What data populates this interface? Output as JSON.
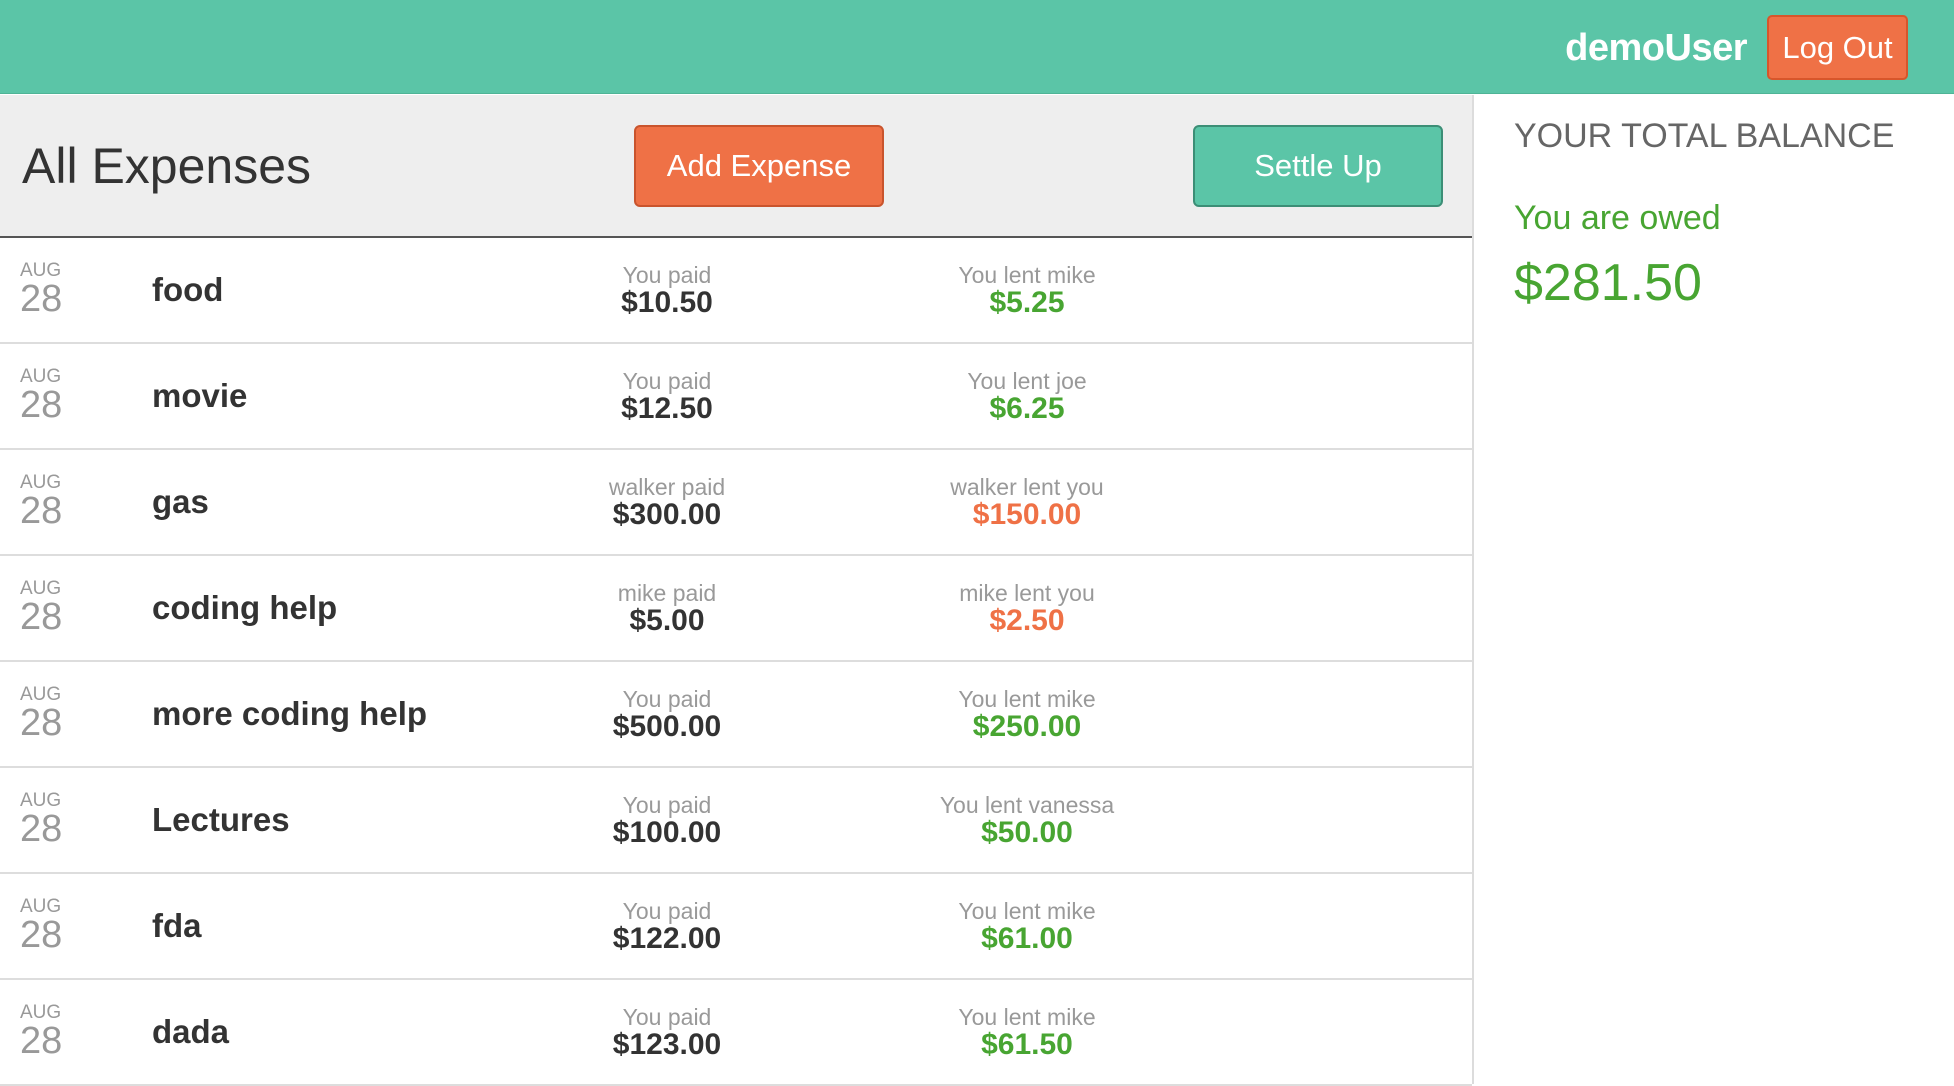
{
  "header": {
    "username": "demoUser",
    "logout_label": "Log Out"
  },
  "main": {
    "title": "All Expenses",
    "add_expense_label": "Add Expense",
    "settle_up_label": "Settle Up"
  },
  "expenses": [
    {
      "month": "AUG",
      "day": "28",
      "description": "food",
      "paid_label": "You paid",
      "paid_amount": "$10.50",
      "lent_label": "You lent mike",
      "lent_amount": "$5.25",
      "lent_status": "positive"
    },
    {
      "month": "AUG",
      "day": "28",
      "description": "movie",
      "paid_label": "You paid",
      "paid_amount": "$12.50",
      "lent_label": "You lent joe",
      "lent_amount": "$6.25",
      "lent_status": "positive"
    },
    {
      "month": "AUG",
      "day": "28",
      "description": "gas",
      "paid_label": "walker paid",
      "paid_amount": "$300.00",
      "lent_label": "walker lent you",
      "lent_amount": "$150.00",
      "lent_status": "negative"
    },
    {
      "month": "AUG",
      "day": "28",
      "description": "coding help",
      "paid_label": "mike paid",
      "paid_amount": "$5.00",
      "lent_label": "mike lent you",
      "lent_amount": "$2.50",
      "lent_status": "negative"
    },
    {
      "month": "AUG",
      "day": "28",
      "description": "more coding help",
      "paid_label": "You paid",
      "paid_amount": "$500.00",
      "lent_label": "You lent mike",
      "lent_amount": "$250.00",
      "lent_status": "positive"
    },
    {
      "month": "AUG",
      "day": "28",
      "description": "Lectures",
      "paid_label": "You paid",
      "paid_amount": "$100.00",
      "lent_label": "You lent vanessa",
      "lent_amount": "$50.00",
      "lent_status": "positive"
    },
    {
      "month": "AUG",
      "day": "28",
      "description": "fda",
      "paid_label": "You paid",
      "paid_amount": "$122.00",
      "lent_label": "You lent mike",
      "lent_amount": "$61.00",
      "lent_status": "positive"
    },
    {
      "month": "AUG",
      "day": "28",
      "description": "dada",
      "paid_label": "You paid",
      "paid_amount": "$123.00",
      "lent_label": "You lent mike",
      "lent_amount": "$61.50",
      "lent_status": "positive"
    }
  ],
  "balance": {
    "title": "YOUR TOTAL BALANCE",
    "status": "You are owed",
    "amount": "$281.50"
  },
  "colors": {
    "brand_green": "#5bc5a7",
    "accent_orange": "#ef7146",
    "positive": "#48a532",
    "negative": "#ef7146"
  }
}
